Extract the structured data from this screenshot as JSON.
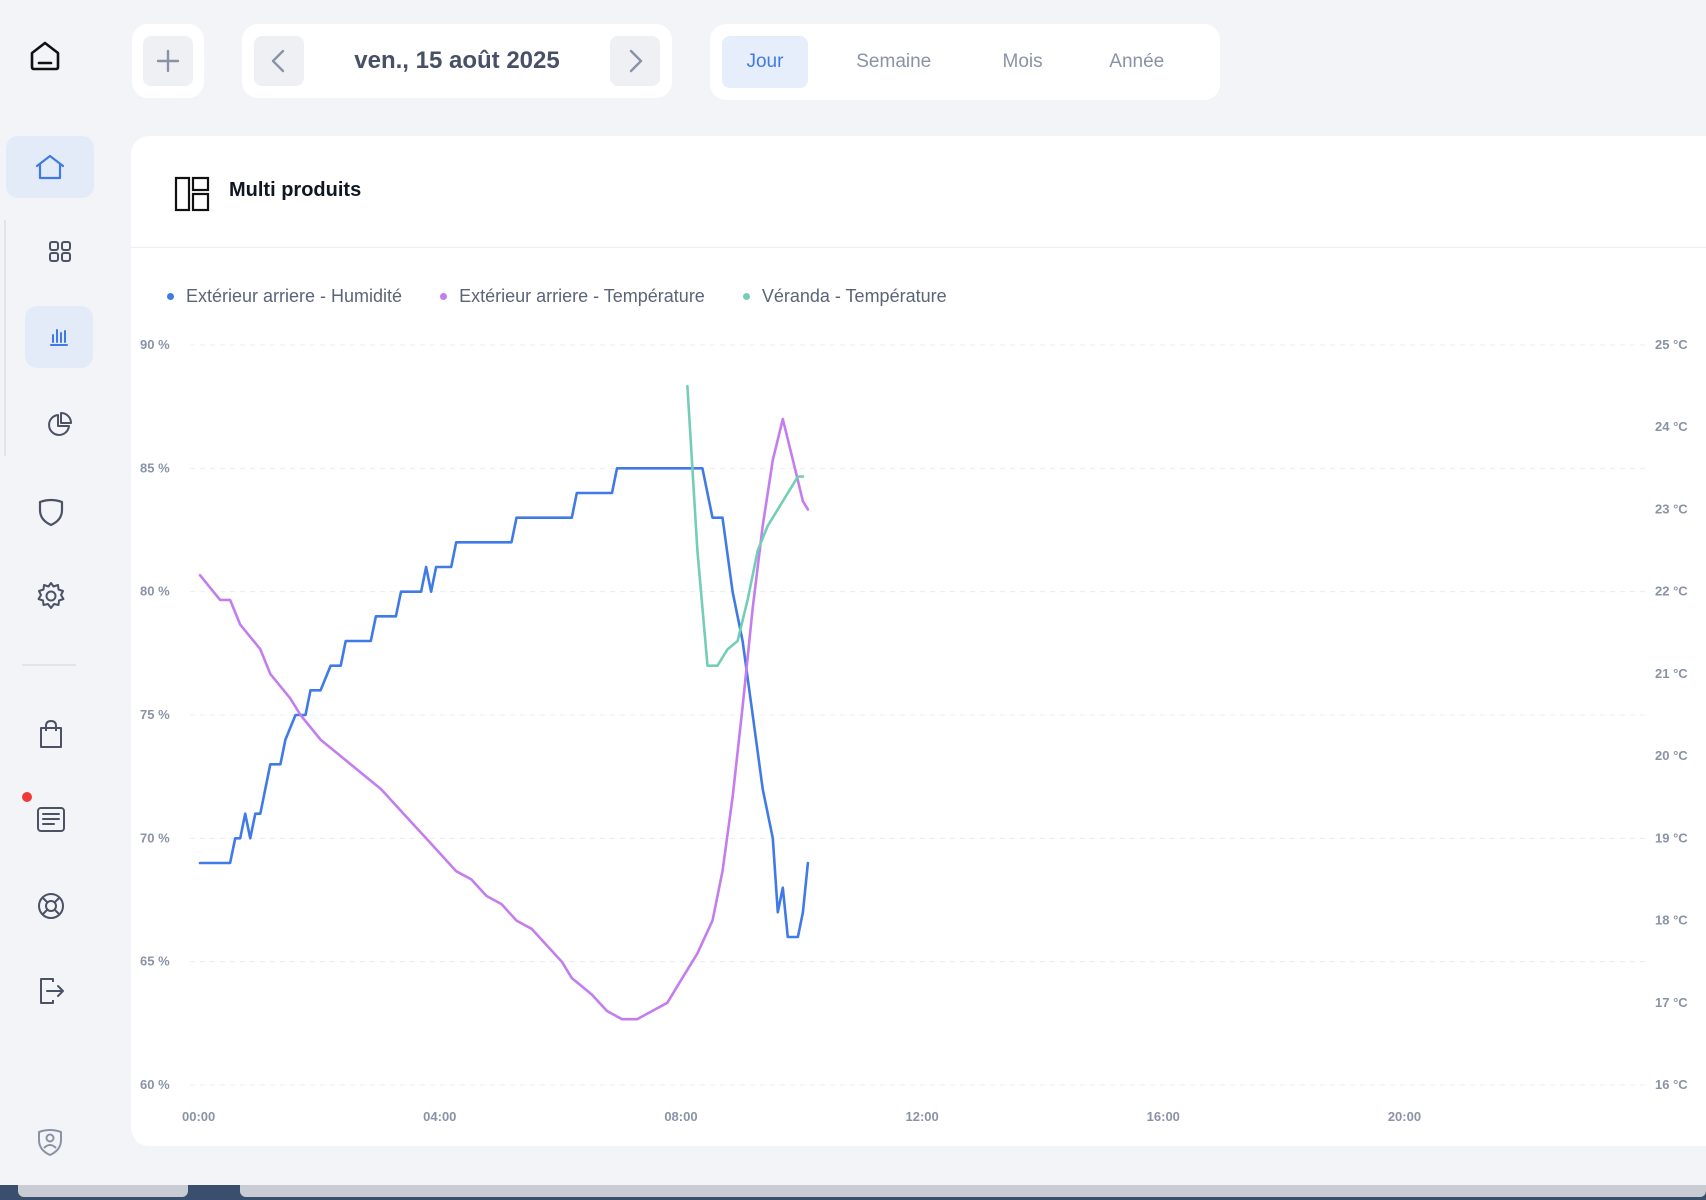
{
  "topbar": {
    "date_label": "ven., 15 août 2025",
    "periods": [
      "Jour",
      "Semaine",
      "Mois",
      "Année"
    ],
    "active_period": "Jour"
  },
  "sidebar": {
    "items": [
      "home-icon",
      "dashboard-grid-icon",
      "bar-chart-icon",
      "pie-chart-icon",
      "shield-icon",
      "gear-icon",
      "shopping-bag-icon",
      "news-icon",
      "support-lifebuoy-icon",
      "logout-icon",
      "privacy-shield-icon"
    ],
    "active_item": "home-icon",
    "notification_color": "#ef3a3a"
  },
  "panel": {
    "title": "Multi produits"
  },
  "chart_data": {
    "type": "line",
    "x_ticks": [
      "00:00",
      "04:00",
      "08:00",
      "12:00",
      "16:00",
      "20:00"
    ],
    "x_range": [
      "00:00",
      "24:00"
    ],
    "y_left": {
      "range": [
        60,
        90
      ],
      "ticks": [
        "60 %",
        "65 %",
        "70 %",
        "75 %",
        "80 %",
        "85 %",
        "90 %"
      ]
    },
    "y_right": {
      "range": [
        16,
        25
      ],
      "ticks": [
        "16 °C",
        "17 °C",
        "18 °C",
        "19 °C",
        "20 °C",
        "21 °C",
        "22 °C",
        "23 °C",
        "24 °C",
        "25 °C"
      ]
    },
    "grid": true,
    "legend_position": "top-left",
    "series": [
      {
        "name": "Extérieur arriere - Humidité",
        "axis": "left",
        "color": "#3f7ae8",
        "points": [
          [
            "00:00",
            69
          ],
          [
            "00:30",
            69
          ],
          [
            "00:35",
            70
          ],
          [
            "00:40",
            70
          ],
          [
            "00:45",
            71
          ],
          [
            "00:50",
            70
          ],
          [
            "00:55",
            71
          ],
          [
            "01:00",
            71
          ],
          [
            "01:10",
            73
          ],
          [
            "01:20",
            73
          ],
          [
            "01:25",
            74
          ],
          [
            "01:35",
            75
          ],
          [
            "01:45",
            75
          ],
          [
            "01:50",
            76
          ],
          [
            "02:00",
            76
          ],
          [
            "02:10",
            77
          ],
          [
            "02:20",
            77
          ],
          [
            "02:25",
            78
          ],
          [
            "02:50",
            78
          ],
          [
            "02:55",
            79
          ],
          [
            "03:15",
            79
          ],
          [
            "03:20",
            80
          ],
          [
            "03:40",
            80
          ],
          [
            "03:45",
            81
          ],
          [
            "03:50",
            80
          ],
          [
            "03:55",
            81
          ],
          [
            "04:10",
            81
          ],
          [
            "04:15",
            82
          ],
          [
            "05:10",
            82
          ],
          [
            "05:15",
            83
          ],
          [
            "06:10",
            83
          ],
          [
            "06:15",
            84
          ],
          [
            "06:50",
            84
          ],
          [
            "06:55",
            85
          ],
          [
            "08:20",
            85
          ],
          [
            "08:30",
            83
          ],
          [
            "08:40",
            83
          ],
          [
            "08:50",
            80
          ],
          [
            "09:00",
            78
          ],
          [
            "09:10",
            75
          ],
          [
            "09:20",
            72
          ],
          [
            "09:30",
            70
          ],
          [
            "09:35",
            67
          ],
          [
            "09:40",
            68
          ],
          [
            "09:45",
            66
          ],
          [
            "09:55",
            66
          ],
          [
            "10:00",
            67
          ],
          [
            "10:05",
            69
          ]
        ]
      },
      {
        "name": "Extérieur arriere - Température",
        "axis": "right",
        "color": "#c47ded",
        "points": [
          [
            "00:00",
            22.2
          ],
          [
            "00:20",
            21.9
          ],
          [
            "00:30",
            21.9
          ],
          [
            "00:40",
            21.6
          ],
          [
            "01:00",
            21.3
          ],
          [
            "01:10",
            21.0
          ],
          [
            "01:30",
            20.7
          ],
          [
            "01:40",
            20.5
          ],
          [
            "02:00",
            20.2
          ],
          [
            "02:20",
            20.0
          ],
          [
            "02:40",
            19.8
          ],
          [
            "03:00",
            19.6
          ],
          [
            "03:15",
            19.4
          ],
          [
            "03:30",
            19.2
          ],
          [
            "03:45",
            19.0
          ],
          [
            "04:00",
            18.8
          ],
          [
            "04:15",
            18.6
          ],
          [
            "04:30",
            18.5
          ],
          [
            "04:45",
            18.3
          ],
          [
            "05:00",
            18.2
          ],
          [
            "05:15",
            18.0
          ],
          [
            "05:30",
            17.9
          ],
          [
            "05:45",
            17.7
          ],
          [
            "06:00",
            17.5
          ],
          [
            "06:10",
            17.3
          ],
          [
            "06:20",
            17.2
          ],
          [
            "06:30",
            17.1
          ],
          [
            "06:45",
            16.9
          ],
          [
            "07:00",
            16.8
          ],
          [
            "07:15",
            16.8
          ],
          [
            "07:30",
            16.9
          ],
          [
            "07:45",
            17.0
          ],
          [
            "08:00",
            17.3
          ],
          [
            "08:15",
            17.6
          ],
          [
            "08:30",
            18.0
          ],
          [
            "08:40",
            18.6
          ],
          [
            "08:50",
            19.5
          ],
          [
            "09:00",
            20.6
          ],
          [
            "09:10",
            21.8
          ],
          [
            "09:20",
            22.8
          ],
          [
            "09:30",
            23.6
          ],
          [
            "09:40",
            24.1
          ],
          [
            "09:50",
            23.6
          ],
          [
            "10:00",
            23.1
          ],
          [
            "10:05",
            23.0
          ]
        ]
      },
      {
        "name": "Véranda - Température",
        "axis": "right",
        "color": "#74cdb7",
        "points": [
          [
            "08:05",
            24.5
          ],
          [
            "08:15",
            22.5
          ],
          [
            "08:25",
            21.1
          ],
          [
            "08:35",
            21.1
          ],
          [
            "08:45",
            21.3
          ],
          [
            "08:55",
            21.4
          ],
          [
            "09:05",
            21.9
          ],
          [
            "09:15",
            22.5
          ],
          [
            "09:25",
            22.8
          ],
          [
            "09:35",
            23.0
          ],
          [
            "09:45",
            23.2
          ],
          [
            "09:55",
            23.4
          ],
          [
            "10:00",
            23.4
          ]
        ]
      }
    ]
  }
}
